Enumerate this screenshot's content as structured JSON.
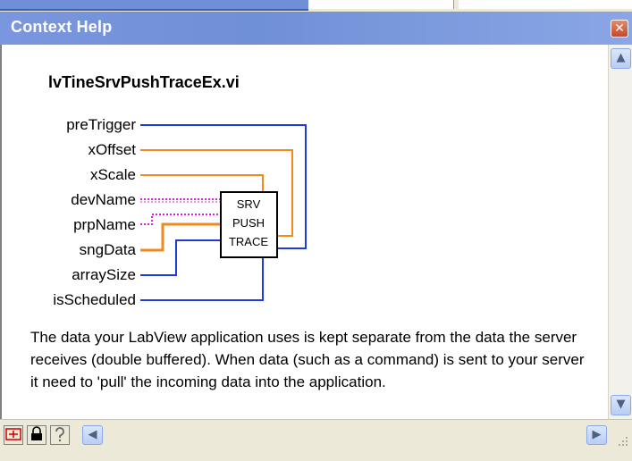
{
  "window": {
    "title": "Context Help",
    "close_glyph": "✕"
  },
  "vi_name": "lvTineSrvPushTraceEx.vi",
  "node": {
    "lines": [
      "SRV",
      "PUSH",
      "TRACE"
    ]
  },
  "terminals": [
    {
      "label": "preTrigger"
    },
    {
      "label": "xOffset"
    },
    {
      "label": "xScale"
    },
    {
      "label": "devName"
    },
    {
      "label": "prpName"
    },
    {
      "label": "sngData"
    },
    {
      "label": "arraySize"
    },
    {
      "label": "isScheduled"
    }
  ],
  "description": "The data your LabView application uses is kept separate from the data the server receives (double buffered).  When data (such as a command) is sent to your server it need to 'pull' the incoming data into the application.",
  "toolbar": {
    "icons": [
      "hierarchy-icon",
      "lock-icon",
      "question-icon"
    ]
  },
  "colors": {
    "wire_blue": "#1f3bd6",
    "wire_orange": "#f08a1e",
    "wire_pink": "#e020e0",
    "titlebar": "#7a96df"
  }
}
